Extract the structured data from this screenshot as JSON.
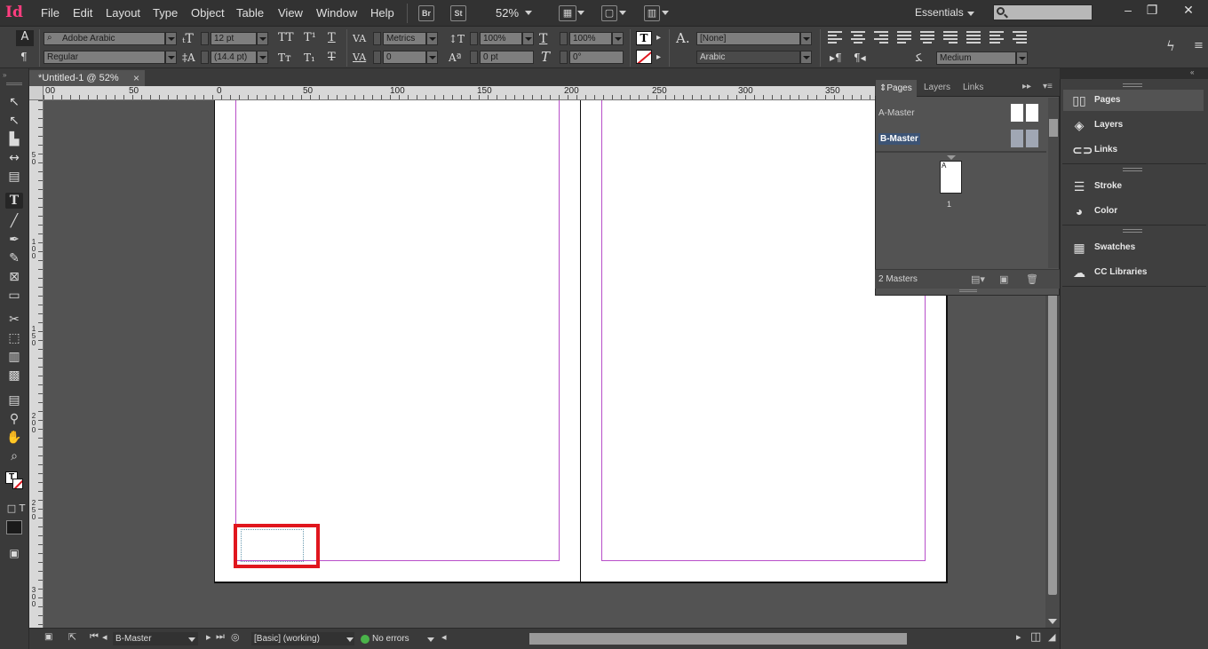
{
  "app": {
    "logo": "Id",
    "menu": [
      "File",
      "Edit",
      "Layout",
      "Type",
      "Object",
      "Table",
      "View",
      "Window",
      "Help"
    ],
    "bridge_label": "Br",
    "stock_label": "St",
    "zoom": "52%",
    "workspace": "Essentials",
    "window_buttons": [
      "–",
      "❐",
      "✕"
    ]
  },
  "control_panel": {
    "char_icon": "A",
    "para_icon": "¶",
    "font_family": "Adobe Arabic",
    "font_style": "Regular",
    "font_size": "12 pt",
    "leading": "(14.4 pt)",
    "kerning": "Metrics",
    "tracking": "0",
    "vertical_scale": "100%",
    "horizontal_scale": "100%",
    "baseline_shift": "0 pt",
    "skew": "0°",
    "char_style": "[None]",
    "language": "Arabic",
    "kashida": "Medium"
  },
  "document": {
    "tab_title": "*Untitled-1 @ 52%",
    "hruler_labels": [
      "00",
      "50",
      "0",
      "50",
      "100",
      "150",
      "200",
      "250",
      "300",
      "350"
    ],
    "vruler_labels": [
      "5 0",
      "1 0 0",
      "1 5 0",
      "2 0 0",
      "2 5 0",
      "3 0 0"
    ]
  },
  "status_bar": {
    "page": "B-Master",
    "preflight_profile": "[Basic] (working)",
    "errors": "No errors"
  },
  "pages_panel": {
    "tabs": [
      "Pages",
      "Layers",
      "Links"
    ],
    "masters": [
      "A-Master",
      "B-Master"
    ],
    "page_thumb_prefix": "A",
    "page_number": "1",
    "footer": "2 Masters"
  },
  "dock": {
    "items": [
      "Pages",
      "Layers",
      "Links",
      "Stroke",
      "Color",
      "Swatches",
      "CC Libraries"
    ]
  },
  "colors": {
    "margin_guide": "#b84fc9",
    "highlight": "#e0161e",
    "logo": "#ff3d7f"
  }
}
